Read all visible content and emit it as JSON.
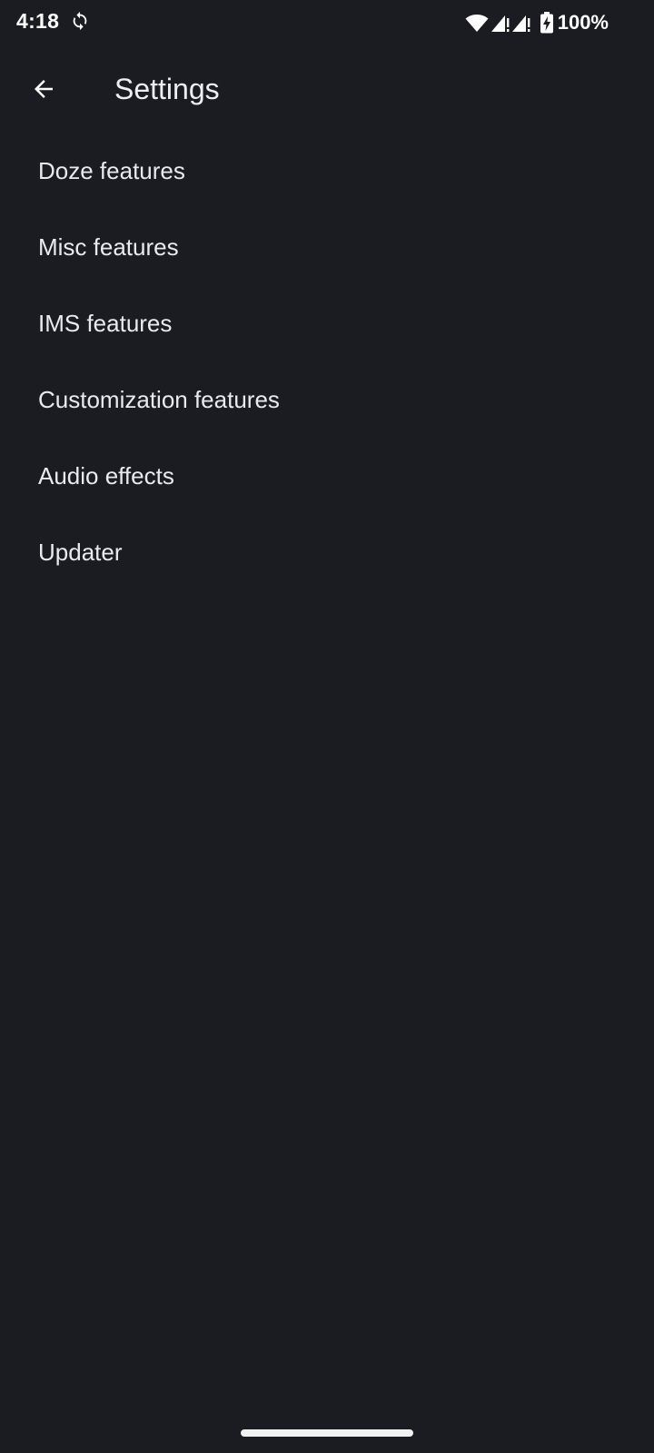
{
  "status_bar": {
    "time": "4:18",
    "battery_percent": "100%",
    "icons": [
      "sync-icon",
      "wifi-icon",
      "signal-icon",
      "signal-icon",
      "battery-charging-icon"
    ]
  },
  "app_bar": {
    "title": "Settings",
    "back_icon": "arrow-left-icon"
  },
  "settings": {
    "items": [
      {
        "label": "Doze features"
      },
      {
        "label": "Misc features"
      },
      {
        "label": "IMS features"
      },
      {
        "label": "Customization features"
      },
      {
        "label": "Audio effects"
      },
      {
        "label": "Updater"
      }
    ]
  },
  "colors": {
    "background": "#1a1c21",
    "text": "#e9eaed",
    "status_text": "#ffffff"
  }
}
